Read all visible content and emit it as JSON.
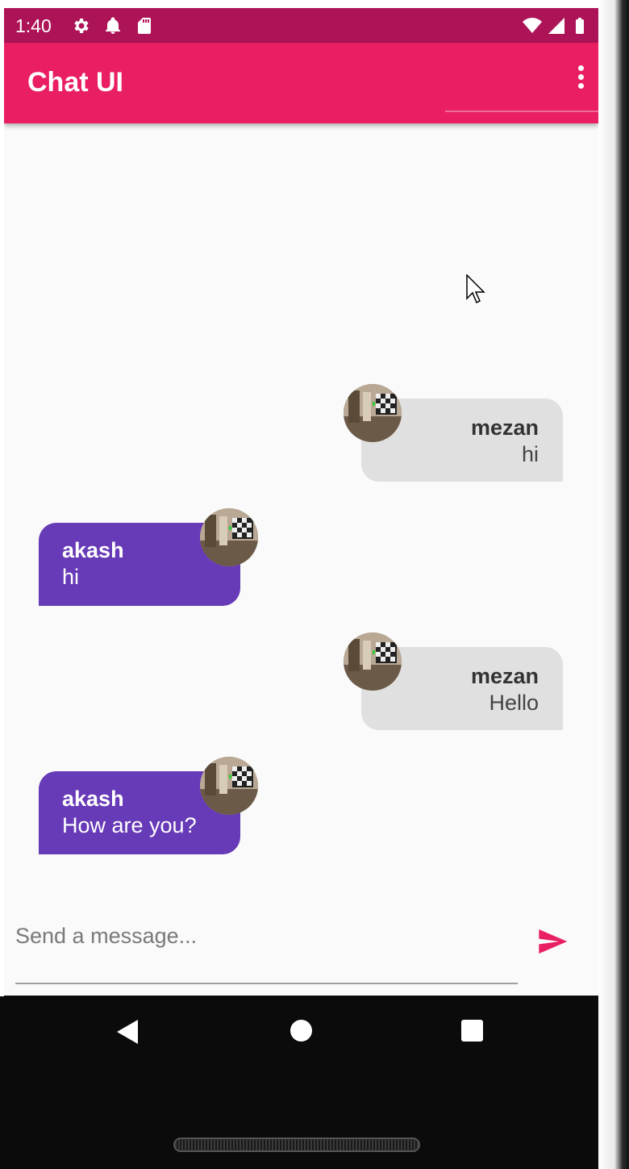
{
  "status_bar": {
    "time": "1:40",
    "left_icons": [
      "settings-icon",
      "notification-bell-icon",
      "sd-card-icon"
    ],
    "right_icons": [
      "wifi-icon",
      "cellular-signal-icon",
      "battery-icon"
    ]
  },
  "app_bar": {
    "title": "Chat UI",
    "menu_icon": "more-vert-icon"
  },
  "messages": [
    {
      "sender": "mezan",
      "text": "hi",
      "side": "right",
      "bubble_color": "#e0e0e0"
    },
    {
      "sender": "akash",
      "text": "hi",
      "side": "left",
      "bubble_color": "#673ab7"
    },
    {
      "sender": "mezan",
      "text": "Hello",
      "side": "right",
      "bubble_color": "#e0e0e0"
    },
    {
      "sender": "akash",
      "text": "How are you?",
      "side": "left",
      "bubble_color": "#673ab7"
    }
  ],
  "composer": {
    "placeholder": "Send a message...",
    "send_icon": "send-icon"
  },
  "nav_bar": {
    "back_icon": "back-triangle-icon",
    "home_icon": "home-circle-icon",
    "recents_icon": "recents-square-icon"
  },
  "colors": {
    "status_bar": "#ad1457",
    "app_bar": "#e91e63",
    "accent": "#e91e63",
    "outgoing_bubble": "#e0e0e0",
    "incoming_bubble": "#673ab7",
    "background": "#fafafa"
  }
}
